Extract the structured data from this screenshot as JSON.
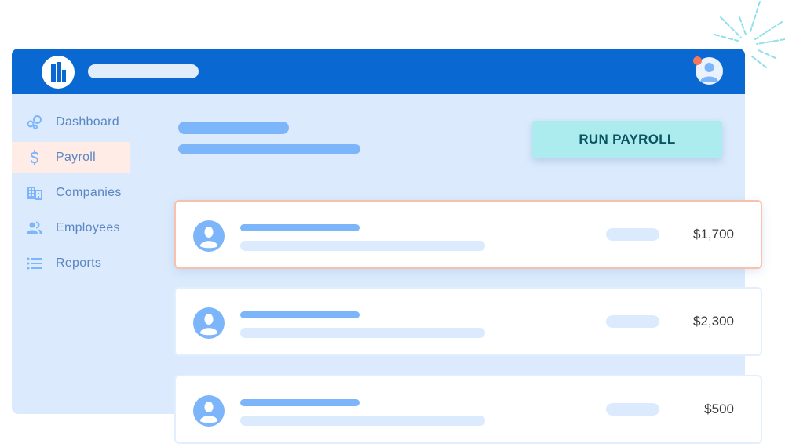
{
  "header": {
    "logo_icon": "building-logo-icon",
    "avatar_icon": "user-avatar-icon",
    "has_notification": true
  },
  "sidebar": {
    "items": [
      {
        "label": "Dashboard",
        "icon": "bubbles-icon",
        "active": false
      },
      {
        "label": "Payroll",
        "icon": "dollar-icon",
        "active": true
      },
      {
        "label": "Companies",
        "icon": "building-icon",
        "active": false
      },
      {
        "label": "Employees",
        "icon": "people-icon",
        "active": false
      },
      {
        "label": "Reports",
        "icon": "list-icon",
        "active": false
      }
    ]
  },
  "main": {
    "run_payroll_label": "RUN PAYROLL",
    "rows": [
      {
        "amount": "$1,700",
        "highlighted": true
      },
      {
        "amount": "$2,300",
        "highlighted": false
      },
      {
        "amount": "$500",
        "highlighted": false
      }
    ]
  },
  "colors": {
    "topbar": "#0a68d2",
    "panel": "#dbebfd",
    "accent_light": "#7db5fb",
    "button": "#adecee",
    "button_text": "#0b5563",
    "active_nav": "#ffece6",
    "notification": "#f5785a",
    "highlight_border": "#f9c0ad"
  }
}
